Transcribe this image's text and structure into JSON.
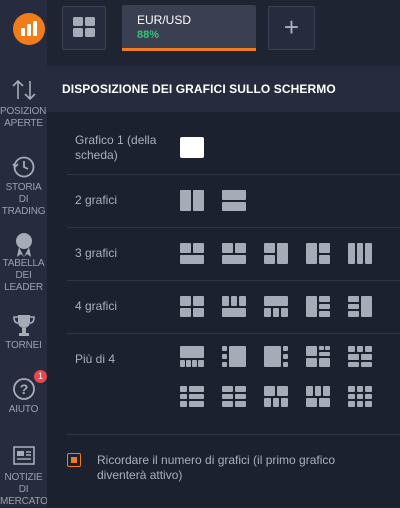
{
  "sidebar": {
    "items": [
      {
        "label": "POSIZIONI APERTE",
        "icon": "arrows-updown-icon"
      },
      {
        "label": "STORIA DI TRADING",
        "icon": "history-clock-icon"
      },
      {
        "label": "TABELLA DEI LEADER",
        "icon": "medal-icon"
      },
      {
        "label": "TORNEI",
        "icon": "trophy-icon"
      },
      {
        "label": "AIUTO",
        "icon": "help-icon",
        "badge": "1"
      },
      {
        "label": "NOTIZIE DI MERCATO",
        "icon": "news-icon"
      }
    ]
  },
  "topbar": {
    "asset": {
      "name": "EUR/USD",
      "pct": "88%"
    },
    "plus": "+"
  },
  "panel": {
    "title": "DISPOSIZIONE DEI GRAFICI SULLO SCHERMO",
    "rows": {
      "one": "Grafico 1 (della scheda)",
      "two": "2 grafici",
      "three": "3 grafici",
      "four": "4 grafici",
      "more": "Più di 4"
    },
    "remember": "Ricordare il numero di grafici (il primo grafico diventerà attivo)"
  },
  "colors": {
    "accent": "#f17d1a",
    "green": "#2ec972",
    "background": "#1f2433"
  }
}
